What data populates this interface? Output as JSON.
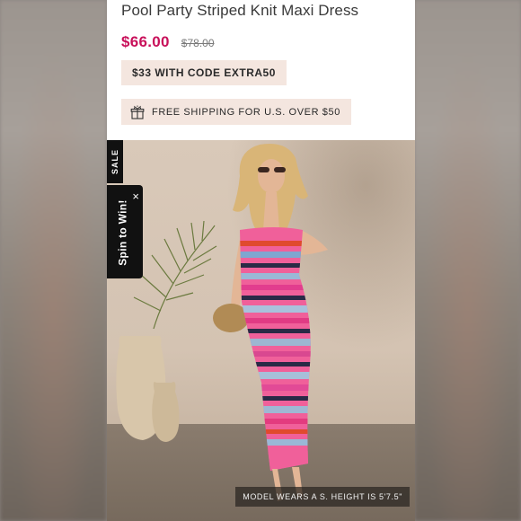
{
  "product": {
    "title": "Pool Party Striped Knit Maxi Dress",
    "price_sale": "$66.00",
    "price_original": "$78.00"
  },
  "promo": {
    "code_text": "$33 WITH CODE EXTRA50"
  },
  "shipping": {
    "text": "FREE SHIPPING FOR U.S. OVER $50",
    "icon": "gift-icon"
  },
  "hero": {
    "sale_badge": "SALE",
    "spin_label": "Spin to Win!",
    "spin_close": "×",
    "model_caption": "MODEL WEARS A S. HEIGHT IS 5'7.5\""
  },
  "colors": {
    "sale_price": "#c8105a",
    "promo_bg": "#f4e6df",
    "badge_bg": "#111111"
  }
}
